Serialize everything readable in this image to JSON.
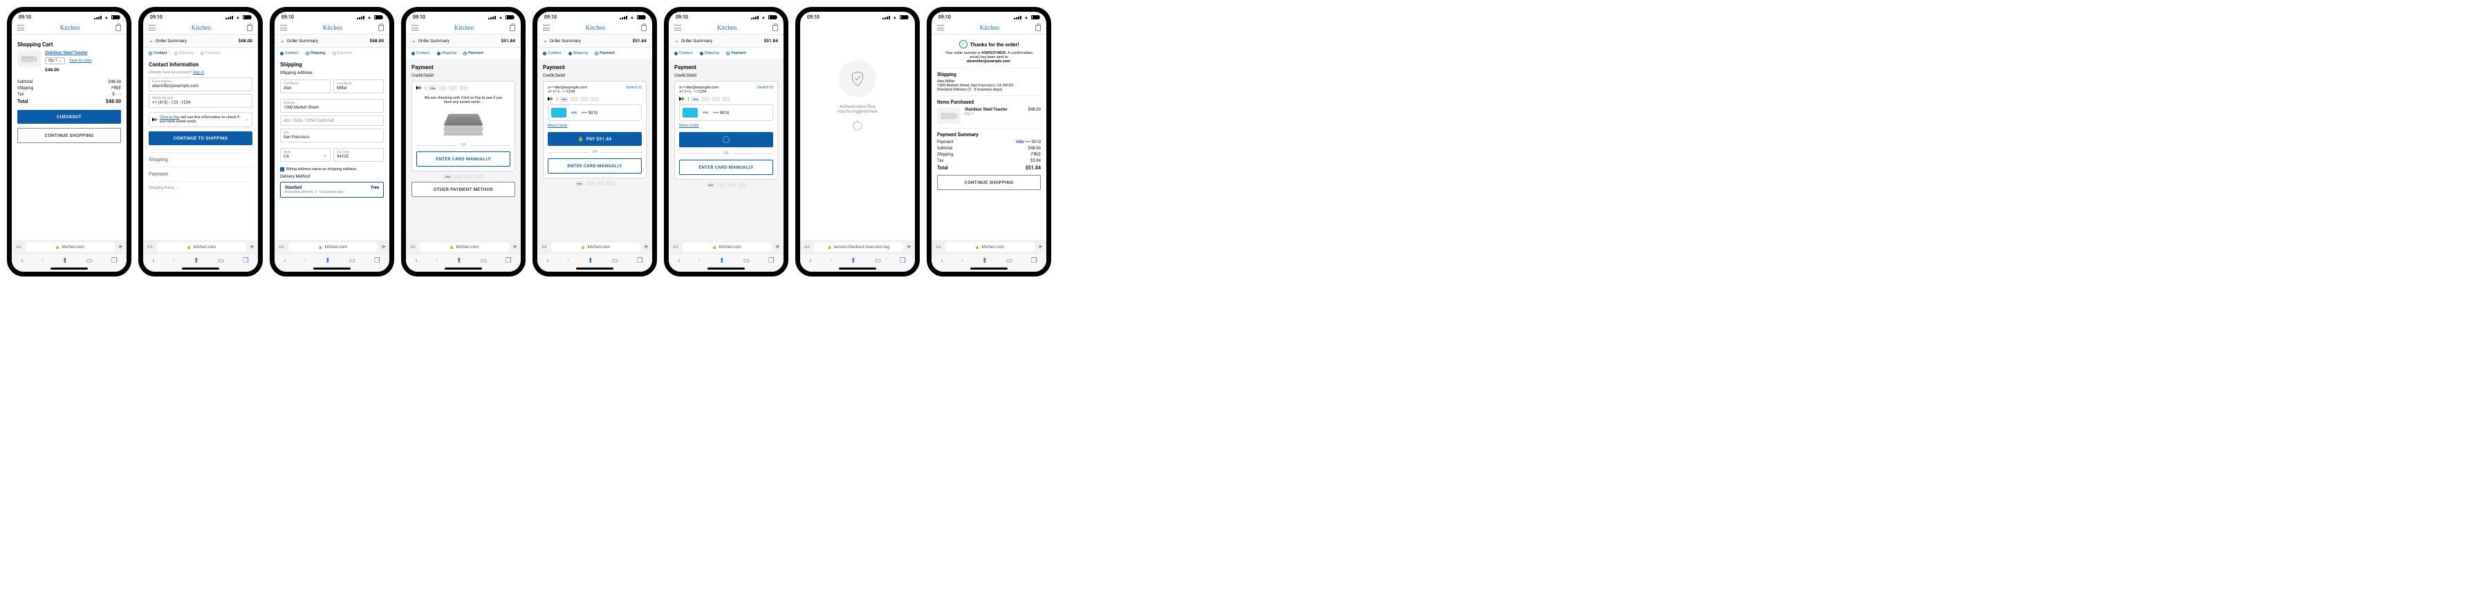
{
  "status": {
    "time": "09:10"
  },
  "brand": "Kitchen",
  "url": "kitchen.com",
  "visa_url": "secure.checkout.visa.com/reg",
  "aa": "AA",
  "s1": {
    "title": "Shopping Cart",
    "product": "Stainless Steel Toaster",
    "qty": "Qty 1",
    "save": "Save for later",
    "price": "$48.00",
    "subtotal_l": "Subtotal",
    "subtotal_v": "$48.00",
    "shipping_l": "Shipping",
    "shipping_v": "FREE",
    "tax_l": "Tax",
    "tax_v": "$ - . -",
    "total_l": "Total",
    "total_v": "$48.00",
    "checkout": "CHECKOUT",
    "continue": "CONTINUE SHOPPING"
  },
  "summary": {
    "label": "Order Summary",
    "v48": "$48.00",
    "v51": "$51.84"
  },
  "steps": {
    "contact": "Contact",
    "shipping": "Shipping",
    "payment": "Payment"
  },
  "s2": {
    "title": "Contact Information",
    "already": "Already have an account?",
    "signin": "Sign In",
    "email_l": "Email Address",
    "email_v": "alexmiller@example.com",
    "mobile_l": "Mobile Number",
    "mobile_v": "+1 (415) - 123 - 1234",
    "c2p": "Click to Pay",
    "c2p_txt": " will use this information to check if you have saved cards.",
    "btn": "CONTINUE TO SHIPPING",
    "ship_h": "Shipping",
    "pay_h": "Payment",
    "policy": "Shipping Policy →"
  },
  "s3": {
    "title": "Shipping",
    "subtitle": "Shipping Address",
    "fn_l": "First Name",
    "fn_v": "Alex",
    "ln_l": "Last Name",
    "ln_v": "Miller",
    "addr_l": "Address",
    "addr_v": "1000 Market Street",
    "apt": "Apt / Suite / Other (optional)",
    "city_l": "City",
    "city_v": "San Francisco",
    "state_l": "State",
    "state_v": "CA",
    "zip_l": "Zip Code",
    "zip_v": "94105",
    "billing": "Billing address same as shipping address",
    "method": "Delivery Method",
    "std": "Standard",
    "free": "Free",
    "est": "Estimated delivery: 3 - 5 business days"
  },
  "s4": {
    "title": "Payment",
    "cd": "Credit/Debit",
    "checking": "We are checking with Click to Pay to see if you have any saved cards...",
    "enter": "ENTER CARD MANUALLY",
    "other": "OTHER PAYMENT METHOD",
    "or": "OR"
  },
  "s5": {
    "masked_email": "a••••iller@example.com",
    "masked_phone": "+1 (•••) - •••1234",
    "switch": "Switch ID",
    "card": "•••• 9010",
    "more": "More Cards",
    "pay": "PAY $51.84"
  },
  "s7": {
    "line1": "Authentication flow",
    "line2": "may be triggered here"
  },
  "s8": {
    "thanks": "Thanks for the order!",
    "ord1": "Your order number is ",
    "ordno": "#3892374829.",
    "ord2": " A confirmation email has been sent to",
    "email": "alexmiller@example.com",
    "ship_h": "Shipping",
    "name": "Alex Miller",
    "addr": "1000 Market Street, San Francisco, CA 94105",
    "del": "Standard Delivery (3 - 5 business days)",
    "items_h": "Items Purchased",
    "prod": "Stainless Steel Toaster",
    "qty": "Qty: 1",
    "price": "$48.00",
    "sum_h": "Payment Summary",
    "pay_l": "Payment",
    "pay_v": "•••• 9010",
    "sub_l": "Subtotal",
    "sub_v": "$48.00",
    "shp_l": "Shipping",
    "shp_v": "FREE",
    "tax_l": "Tax",
    "tax_v": "$3.84",
    "tot_l": "Total",
    "tot_v": "$51.84",
    "cont": "CONTINUE SHOPPING",
    "visa": "VISA"
  }
}
